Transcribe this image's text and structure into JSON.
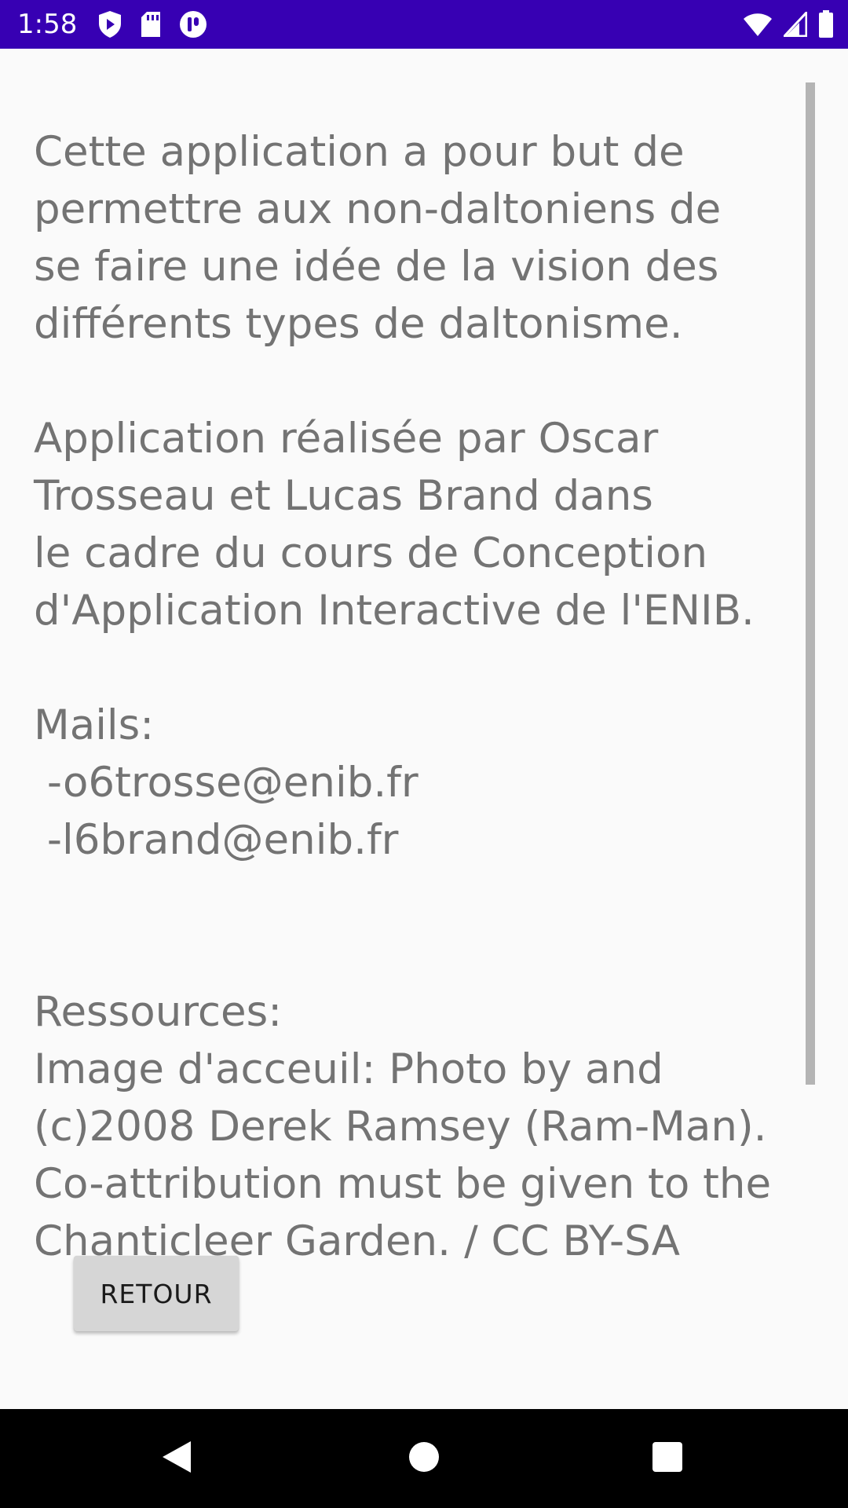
{
  "status_bar": {
    "time": "1:58",
    "icons_left": [
      "play-protect-icon",
      "sd-card-icon",
      "notification-app-icon"
    ],
    "icons_right": [
      "wifi-icon",
      "cell-signal-icon",
      "battery-icon"
    ],
    "background_color": "#3700b3"
  },
  "about": {
    "text": "Cette application a pour but de\npermettre aux non-daltoniens de\nse faire une idée de la vision des\ndifférents types de daltonisme.\n\nApplication réalisée par Oscar\nTrosseau et Lucas Brand dans\nle cadre du cours de Conception\nd'Application Interactive de l'ENIB.\n\nMails:\n -o6trosse@enib.fr\n -l6brand@enib.fr\n\n\nRessources:\nImage d'acceuil: Photo by and\n(c)2008 Derek Ramsey (Ram-Man).\nCo-attribution must be given to the\nChanticleer Garden. / CC BY-SA",
    "text_color": "#737373"
  },
  "buttons": {
    "back_label": "RETOUR"
  },
  "nav_bar": {
    "icons": [
      "back-triangle-icon",
      "home-circle-icon",
      "recents-square-icon"
    ]
  }
}
